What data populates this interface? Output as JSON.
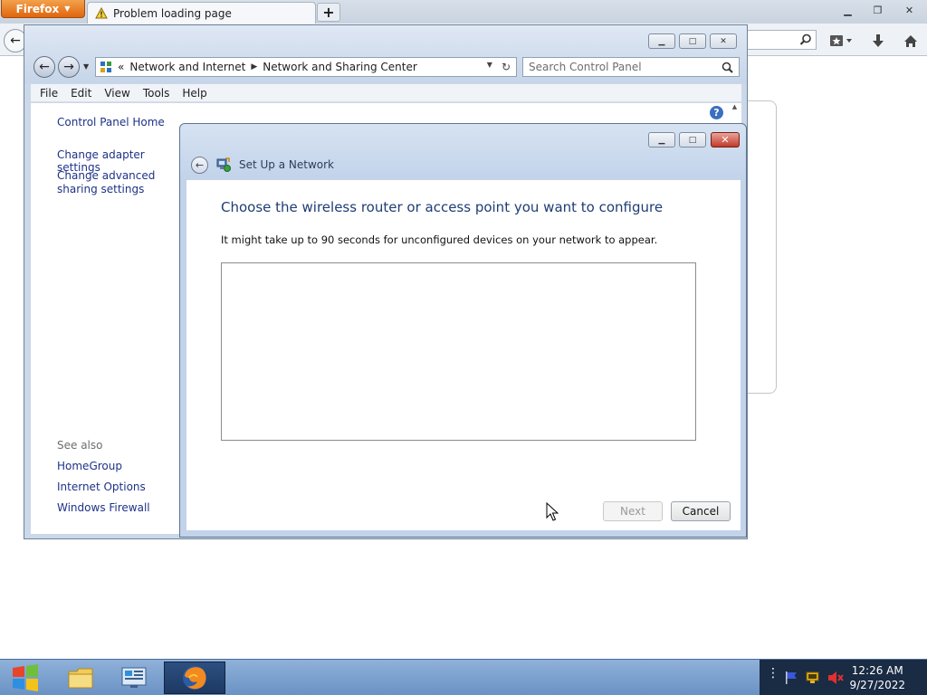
{
  "firefox": {
    "menu_label": "Firefox",
    "tab_title": "Problem loading page",
    "newtab_label": "+"
  },
  "control_panel": {
    "breadcrumb": {
      "overflow": "«",
      "items": [
        "Network and Internet",
        "Network and Sharing Center"
      ]
    },
    "search_placeholder": "Search Control Panel",
    "menu": [
      "File",
      "Edit",
      "View",
      "Tools",
      "Help"
    ],
    "sidebar": {
      "home": "Control Panel Home",
      "links": [
        "Change adapter settings",
        "Change advanced sharing settings"
      ],
      "see_also_heading": "See also",
      "see_also": [
        "HomeGroup",
        "Internet Options",
        "Windows Firewall"
      ]
    },
    "help_glyph": "?"
  },
  "dialog": {
    "window_title": "Set Up a Network",
    "heading": "Choose the wireless router or access point you want to configure",
    "subtext": "It might take up to 90 seconds for unconfigured devices on your network to appear.",
    "next_label": "Next",
    "cancel_label": "Cancel",
    "next_enabled": false
  },
  "taskbar": {
    "time": "12:26 AM",
    "date": "9/27/2022",
    "pinned": [
      "windows-explorer-icon",
      "control-panel-icon",
      "firefox-icon"
    ]
  },
  "colors": {
    "title_text": "#1e3d73",
    "link_text": "#1e3287",
    "firefox_orange": "#e0660f",
    "close_red": "#c2392a",
    "taskbar": "#6a92c4"
  }
}
